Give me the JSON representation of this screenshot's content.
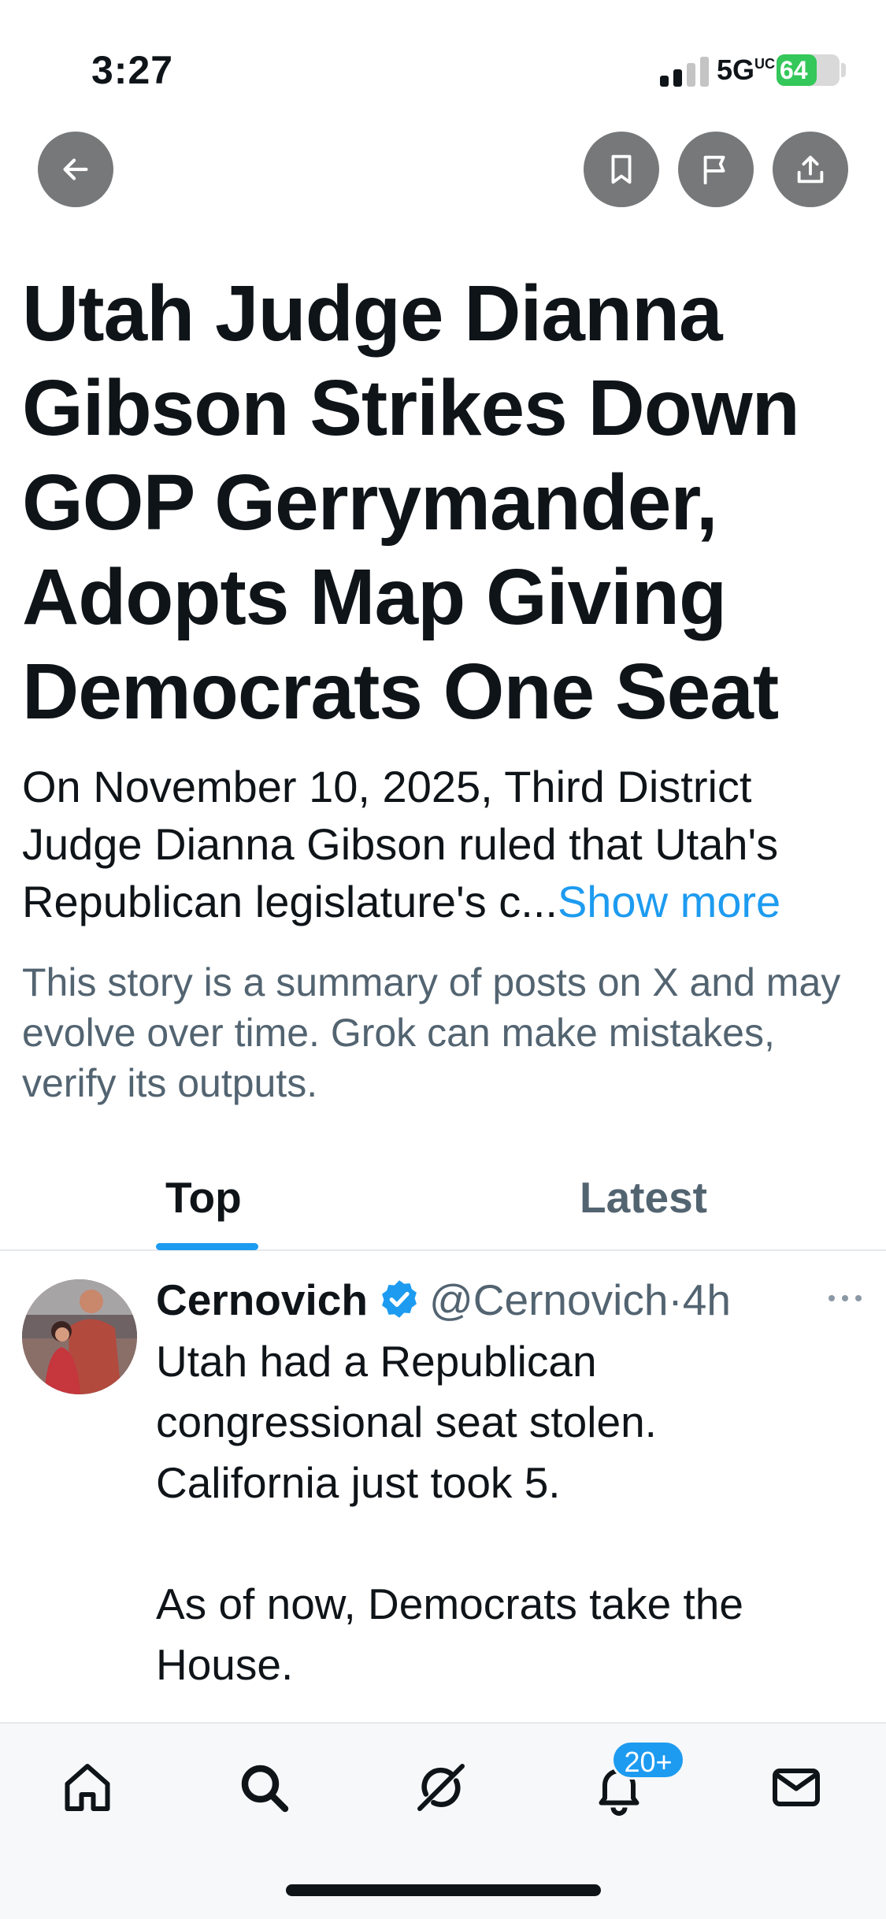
{
  "status_bar": {
    "time": "3:27",
    "network": "5G",
    "network_suffix": "UC",
    "battery": "64",
    "battery_level": 0.64
  },
  "header": {
    "back_icon": "arrow-left-icon",
    "actions": [
      {
        "name": "bookmark",
        "icon": "bookmark-icon"
      },
      {
        "name": "report",
        "icon": "flag-icon"
      },
      {
        "name": "share",
        "icon": "share-icon"
      }
    ]
  },
  "story": {
    "title": "Utah Judge Dianna Gibson Strikes Down GOP Gerrymander, Adopts Map Giving Democrats One Seat",
    "summary": "On November 10, 2025, Third District Judge Dianna Gibson ruled that Utah's Republican legislature's c...",
    "show_more": "Show more",
    "disclaimer": "This story is a summary of posts on X and may evolve over time. Grok can make mistakes, verify its outputs."
  },
  "tabs": [
    {
      "label": "Top",
      "active": true
    },
    {
      "label": "Latest",
      "active": false
    }
  ],
  "post": {
    "author": "Cernovich",
    "verified": true,
    "handle": "@Cernovich",
    "separator": "·",
    "time": "4h",
    "body": [
      "Utah had a Republican",
      "congressional seat stolen.",
      "California just took 5.",
      "",
      "As of now, Democrats take the",
      "House."
    ]
  },
  "bottom_nav": {
    "items": [
      "home-icon",
      "search-icon",
      "grok-icon",
      "notifications-icon",
      "messages-icon"
    ],
    "notification_badge": "20+"
  },
  "colors": {
    "accent": "#1d9bf0",
    "text": "#0f1419",
    "secondary_text": "#536471",
    "button_bg": "#777879",
    "battery": "#34c759"
  }
}
